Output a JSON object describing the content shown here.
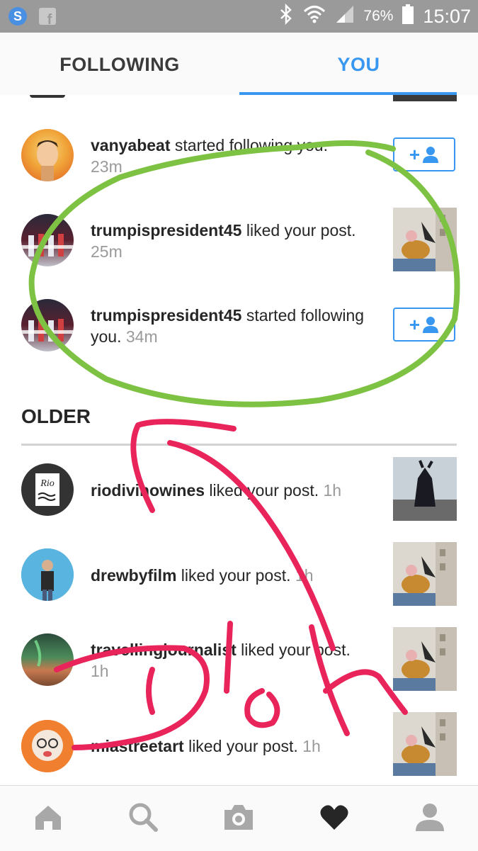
{
  "status_bar": {
    "battery_percent": "76%",
    "time": "15:07",
    "icons": [
      "skype-icon",
      "facebook-icon",
      "bluetooth-icon",
      "wifi-icon",
      "signal-icon",
      "battery-icon"
    ]
  },
  "tabs": {
    "following": "FOLLOWING",
    "you": "YOU",
    "active": "you",
    "accent_color": "#3897f0"
  },
  "notifications": [
    {
      "username": "vanyabeat",
      "action": " started following you.",
      "time": "23m",
      "right": "follow-button"
    },
    {
      "username": "trumpispresident45",
      "action": " liked your post.",
      "time": "25m",
      "right": "post-thumbnail"
    },
    {
      "username": "trumpispresident45",
      "action": " started following you.",
      "time": "34m",
      "right": "follow-button"
    }
  ],
  "older_section": {
    "title": "OLDER",
    "items": [
      {
        "username": "riodivinowines",
        "action": " liked your post.",
        "time": "1h"
      },
      {
        "username": "drewbyfilm",
        "action": " liked your post.",
        "time": "1h"
      },
      {
        "username": "travellingjournalist",
        "action": " liked your post.",
        "time": "1h"
      },
      {
        "username": "miastreetart",
        "action": " liked your post.",
        "time": "1h"
      }
    ]
  },
  "bottom_nav": {
    "items": [
      "home-icon",
      "search-icon",
      "camera-icon",
      "heart-icon",
      "profile-icon"
    ],
    "active": "heart-icon"
  },
  "annotation": {
    "handwritten_text": "Doh",
    "green_color": "#7dc242",
    "red_color": "#e8245a"
  }
}
